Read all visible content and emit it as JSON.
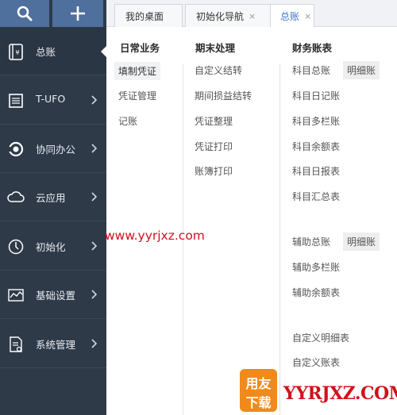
{
  "sidebar": {
    "search_icon": "search-icon",
    "add_icon": "plus-icon",
    "items": [
      {
        "label": "总账",
        "icon": "ledger-book-icon"
      },
      {
        "label": "T-UFO",
        "icon": "report-sheet-icon"
      },
      {
        "label": "协同办公",
        "icon": "collaboration-icon"
      },
      {
        "label": "云应用",
        "icon": "cloud-icon"
      },
      {
        "label": "初始化",
        "icon": "clock-icon"
      },
      {
        "label": "基础设置",
        "icon": "settings-chart-icon"
      },
      {
        "label": "系统管理",
        "icon": "document-gear-icon"
      }
    ]
  },
  "tabs": [
    {
      "label": "我的桌面",
      "closable": false
    },
    {
      "label": "初始化导航",
      "closable": true,
      "close": "×"
    },
    {
      "label": "总账",
      "closable": true,
      "close": "×",
      "active": true
    }
  ],
  "menu": {
    "columns": [
      {
        "title": "日常业务",
        "items": [
          "填制凭证",
          "凭证管理",
          "记账"
        ]
      },
      {
        "title": "期末处理",
        "items": [
          "自定义结转",
          "期间损益结转",
          "凭证整理",
          "凭证打印",
          "账簿打印"
        ]
      },
      {
        "title": "财务账表",
        "items": [
          "科目总账",
          "科目日记账",
          "科目多栏账",
          "科目余额表",
          "科目日报表",
          "科目汇总表",
          "辅助总账",
          "辅助多栏账",
          "辅助余额表",
          "自定义明细表",
          "自定义账表"
        ],
        "pills": [
          "明细账",
          "明细账"
        ]
      }
    ]
  },
  "watermark": {
    "url": "www.yyrjxz.com",
    "logo_top": "用友",
    "logo_bottom": "下载",
    "domain": "YYRJXZ.COM"
  },
  "colors": {
    "sidebar_bg": "#2f3a49",
    "top_button_bg": "#4f6f9c",
    "active_tab_text": "#3a7bd5",
    "watermark_red": "#d0121b",
    "logo_orange": "#f08a1c"
  }
}
